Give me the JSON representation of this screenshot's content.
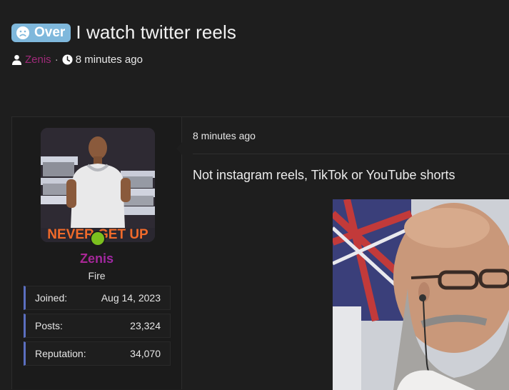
{
  "thread": {
    "prefix": "Over",
    "prefix_icon": "frown-face-icon",
    "title": "I watch twitter reels",
    "author": "Zenis",
    "separator": "·",
    "time": "8 minutes ago"
  },
  "user": {
    "name": "Zenis",
    "title": "Fire",
    "avatar_text": "NEVER GET UP",
    "online": true,
    "stats": [
      {
        "label": "Joined:",
        "value": "Aug 14, 2023"
      },
      {
        "label": "Posts:",
        "value": "23,324"
      },
      {
        "label": "Reputation:",
        "value": "34,070"
      }
    ]
  },
  "post": {
    "date": "8 minutes ago",
    "body": "Not instagram reels, TikTok or YouTube shorts"
  },
  "colors": {
    "prefix_bg": "#7fb8dc",
    "author_link": "#a02a7a",
    "stat_accent": "#5b6fc0",
    "online": "#7bbf1e"
  }
}
